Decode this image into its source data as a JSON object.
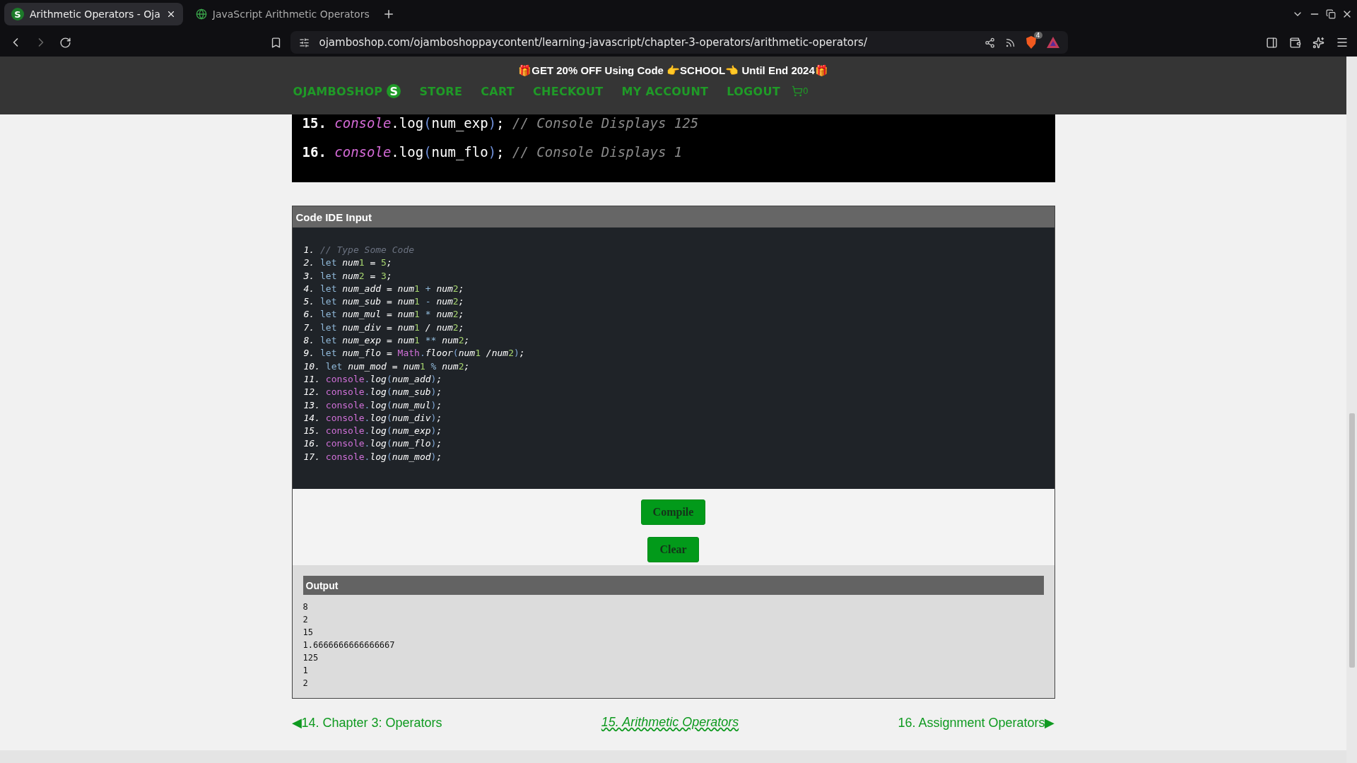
{
  "browser": {
    "tabs": [
      {
        "title": "Arithmetic Operators - Oja",
        "selected": true,
        "logo": "S"
      },
      {
        "title": "JavaScript Arithmetic Operators",
        "selected": false
      }
    ],
    "url": "ojamboshop.com/ojamboshoppaycontent/learning-javascript/chapter-3-operators/arithmetic-operators/",
    "shield_badge": "4"
  },
  "banner": "🎁GET 20% OFF Using Code 👉SCHOOL👈 Until End 2024🎁",
  "nav": {
    "brand": "OJAMBOSHOP",
    "logo": "S",
    "items": [
      "STORE",
      "CART",
      "CHECKOUT",
      "MY ACCOUNT",
      "LOGOUT"
    ],
    "cart_count": "0"
  },
  "snippet": [
    {
      "num": "15.",
      "tokens": [
        {
          "kind": "m",
          "text": "console"
        },
        {
          "kind": "s",
          "text": ".log"
        },
        {
          "kind": "p",
          "text": "("
        },
        {
          "kind": "s",
          "text": "num_exp"
        },
        {
          "kind": "p",
          "text": ")"
        },
        {
          "kind": "s",
          "text": "; "
        },
        {
          "kind": "c",
          "text": "// Console Displays 125"
        }
      ]
    },
    {
      "num": "16.",
      "tokens": [
        {
          "kind": "m",
          "text": "console"
        },
        {
          "kind": "s",
          "text": ".log"
        },
        {
          "kind": "p",
          "text": "("
        },
        {
          "kind": "s",
          "text": "num_flo"
        },
        {
          "kind": "p",
          "text": ")"
        },
        {
          "kind": "s",
          "text": "; "
        },
        {
          "kind": "c",
          "text": "// Console Displays 1"
        }
      ]
    }
  ],
  "ide": {
    "title": "Code IDE Input",
    "lines": [
      {
        "num": "1.",
        "tokens": [
          {
            "kind": "c",
            "text": "// Type Some Code"
          }
        ]
      },
      {
        "num": "2.",
        "tokens": [
          {
            "kind": "k",
            "text": "let "
          },
          {
            "kind": "v",
            "text": "num"
          },
          {
            "kind": "n",
            "text": "1"
          },
          {
            "kind": "s",
            "text": " = "
          },
          {
            "kind": "n",
            "text": "5"
          },
          {
            "kind": "s",
            "text": ";"
          }
        ]
      },
      {
        "num": "3.",
        "tokens": [
          {
            "kind": "k",
            "text": "let "
          },
          {
            "kind": "v",
            "text": "num"
          },
          {
            "kind": "n",
            "text": "2"
          },
          {
            "kind": "s",
            "text": " = "
          },
          {
            "kind": "n",
            "text": "3"
          },
          {
            "kind": "s",
            "text": ";"
          }
        ]
      },
      {
        "num": "4.",
        "tokens": [
          {
            "kind": "k",
            "text": "let "
          },
          {
            "kind": "v",
            "text": "num_add"
          },
          {
            "kind": "s",
            "text": " = "
          },
          {
            "kind": "v",
            "text": "num"
          },
          {
            "kind": "n",
            "text": "1"
          },
          {
            "kind": "o",
            "text": " + "
          },
          {
            "kind": "v",
            "text": "num"
          },
          {
            "kind": "n",
            "text": "2"
          },
          {
            "kind": "s",
            "text": ";"
          }
        ]
      },
      {
        "num": "5.",
        "tokens": [
          {
            "kind": "k",
            "text": "let "
          },
          {
            "kind": "v",
            "text": "num_sub"
          },
          {
            "kind": "s",
            "text": " = "
          },
          {
            "kind": "v",
            "text": "num"
          },
          {
            "kind": "n",
            "text": "1"
          },
          {
            "kind": "o",
            "text": " - "
          },
          {
            "kind": "v",
            "text": "num"
          },
          {
            "kind": "n",
            "text": "2"
          },
          {
            "kind": "s",
            "text": ";"
          }
        ]
      },
      {
        "num": "6.",
        "tokens": [
          {
            "kind": "k",
            "text": "let "
          },
          {
            "kind": "v",
            "text": "num_mul"
          },
          {
            "kind": "s",
            "text": " = "
          },
          {
            "kind": "v",
            "text": "num"
          },
          {
            "kind": "n",
            "text": "1"
          },
          {
            "kind": "o",
            "text": " * "
          },
          {
            "kind": "v",
            "text": "num"
          },
          {
            "kind": "n",
            "text": "2"
          },
          {
            "kind": "s",
            "text": ";"
          }
        ]
      },
      {
        "num": "7.",
        "tokens": [
          {
            "kind": "k",
            "text": "let "
          },
          {
            "kind": "v",
            "text": "num_div"
          },
          {
            "kind": "s",
            "text": " = "
          },
          {
            "kind": "v",
            "text": "num"
          },
          {
            "kind": "n",
            "text": "1"
          },
          {
            "kind": "s",
            "text": " / "
          },
          {
            "kind": "v",
            "text": "num"
          },
          {
            "kind": "n",
            "text": "2"
          },
          {
            "kind": "s",
            "text": ";"
          }
        ]
      },
      {
        "num": "8.",
        "tokens": [
          {
            "kind": "k",
            "text": "let "
          },
          {
            "kind": "v",
            "text": "num_exp"
          },
          {
            "kind": "s",
            "text": " = "
          },
          {
            "kind": "v",
            "text": "num"
          },
          {
            "kind": "n",
            "text": "1"
          },
          {
            "kind": "o",
            "text": " ** "
          },
          {
            "kind": "v",
            "text": "num"
          },
          {
            "kind": "n",
            "text": "2"
          },
          {
            "kind": "s",
            "text": ";"
          }
        ]
      },
      {
        "num": "9.",
        "tokens": [
          {
            "kind": "k",
            "text": "let "
          },
          {
            "kind": "v",
            "text": "num_flo"
          },
          {
            "kind": "s",
            "text": " = "
          },
          {
            "kind": "m",
            "text": "Math"
          },
          {
            "kind": "p",
            "text": "."
          },
          {
            "kind": "f",
            "text": "floor"
          },
          {
            "kind": "p",
            "text": "("
          },
          {
            "kind": "v",
            "text": "num"
          },
          {
            "kind": "n",
            "text": "1"
          },
          {
            "kind": "s",
            "text": " /"
          },
          {
            "kind": "v",
            "text": "num"
          },
          {
            "kind": "n",
            "text": "2"
          },
          {
            "kind": "p",
            "text": ")"
          },
          {
            "kind": "s",
            "text": ";"
          }
        ]
      },
      {
        "num": "10.",
        "tokens": [
          {
            "kind": "k",
            "text": "let "
          },
          {
            "kind": "v",
            "text": "num_mod"
          },
          {
            "kind": "s",
            "text": " = "
          },
          {
            "kind": "v",
            "text": "num"
          },
          {
            "kind": "n",
            "text": "1"
          },
          {
            "kind": "o",
            "text": " % "
          },
          {
            "kind": "v",
            "text": "num"
          },
          {
            "kind": "n",
            "text": "2"
          },
          {
            "kind": "s",
            "text": ";"
          }
        ]
      },
      {
        "num": "11.",
        "tokens": [
          {
            "kind": "m",
            "text": "console"
          },
          {
            "kind": "p",
            "text": "."
          },
          {
            "kind": "f",
            "text": "log"
          },
          {
            "kind": "p",
            "text": "("
          },
          {
            "kind": "v",
            "text": "num_add"
          },
          {
            "kind": "p",
            "text": ")"
          },
          {
            "kind": "s",
            "text": ";"
          }
        ]
      },
      {
        "num": "12.",
        "tokens": [
          {
            "kind": "m",
            "text": "console"
          },
          {
            "kind": "p",
            "text": "."
          },
          {
            "kind": "f",
            "text": "log"
          },
          {
            "kind": "p",
            "text": "("
          },
          {
            "kind": "v",
            "text": "num_sub"
          },
          {
            "kind": "p",
            "text": ")"
          },
          {
            "kind": "s",
            "text": ";"
          }
        ]
      },
      {
        "num": "13.",
        "tokens": [
          {
            "kind": "m",
            "text": "console"
          },
          {
            "kind": "p",
            "text": "."
          },
          {
            "kind": "f",
            "text": "log"
          },
          {
            "kind": "p",
            "text": "("
          },
          {
            "kind": "v",
            "text": "num_mul"
          },
          {
            "kind": "p",
            "text": ")"
          },
          {
            "kind": "s",
            "text": ";"
          }
        ]
      },
      {
        "num": "14.",
        "tokens": [
          {
            "kind": "m",
            "text": "console"
          },
          {
            "kind": "p",
            "text": "."
          },
          {
            "kind": "f",
            "text": "log"
          },
          {
            "kind": "p",
            "text": "("
          },
          {
            "kind": "v",
            "text": "num_div"
          },
          {
            "kind": "p",
            "text": ")"
          },
          {
            "kind": "s",
            "text": ";"
          }
        ]
      },
      {
        "num": "15.",
        "tokens": [
          {
            "kind": "m",
            "text": "console"
          },
          {
            "kind": "p",
            "text": "."
          },
          {
            "kind": "f",
            "text": "log"
          },
          {
            "kind": "p",
            "text": "("
          },
          {
            "kind": "v",
            "text": "num_exp"
          },
          {
            "kind": "p",
            "text": ")"
          },
          {
            "kind": "s",
            "text": ";"
          }
        ]
      },
      {
        "num": "16.",
        "tokens": [
          {
            "kind": "m",
            "text": "console"
          },
          {
            "kind": "p",
            "text": "."
          },
          {
            "kind": "f",
            "text": "log"
          },
          {
            "kind": "p",
            "text": "("
          },
          {
            "kind": "v",
            "text": "num_flo"
          },
          {
            "kind": "p",
            "text": ")"
          },
          {
            "kind": "s",
            "text": ";"
          }
        ]
      },
      {
        "num": "17.",
        "tokens": [
          {
            "kind": "m",
            "text": "console"
          },
          {
            "kind": "p",
            "text": "."
          },
          {
            "kind": "f",
            "text": "log"
          },
          {
            "kind": "p",
            "text": "("
          },
          {
            "kind": "v",
            "text": "num_mod"
          },
          {
            "kind": "p",
            "text": ")"
          },
          {
            "kind": "s",
            "text": ";"
          }
        ]
      }
    ],
    "buttons": [
      "Compile",
      "Clear"
    ],
    "output_title": "Output",
    "output": [
      "8",
      "2",
      "15",
      "1.6666666666666667",
      "125",
      "1",
      "2"
    ]
  },
  "pager": {
    "prev": "◀14. Chapter 3: Operators",
    "current": "15. Arithmetic Operators",
    "next": "16. Assignment Operators▶"
  }
}
